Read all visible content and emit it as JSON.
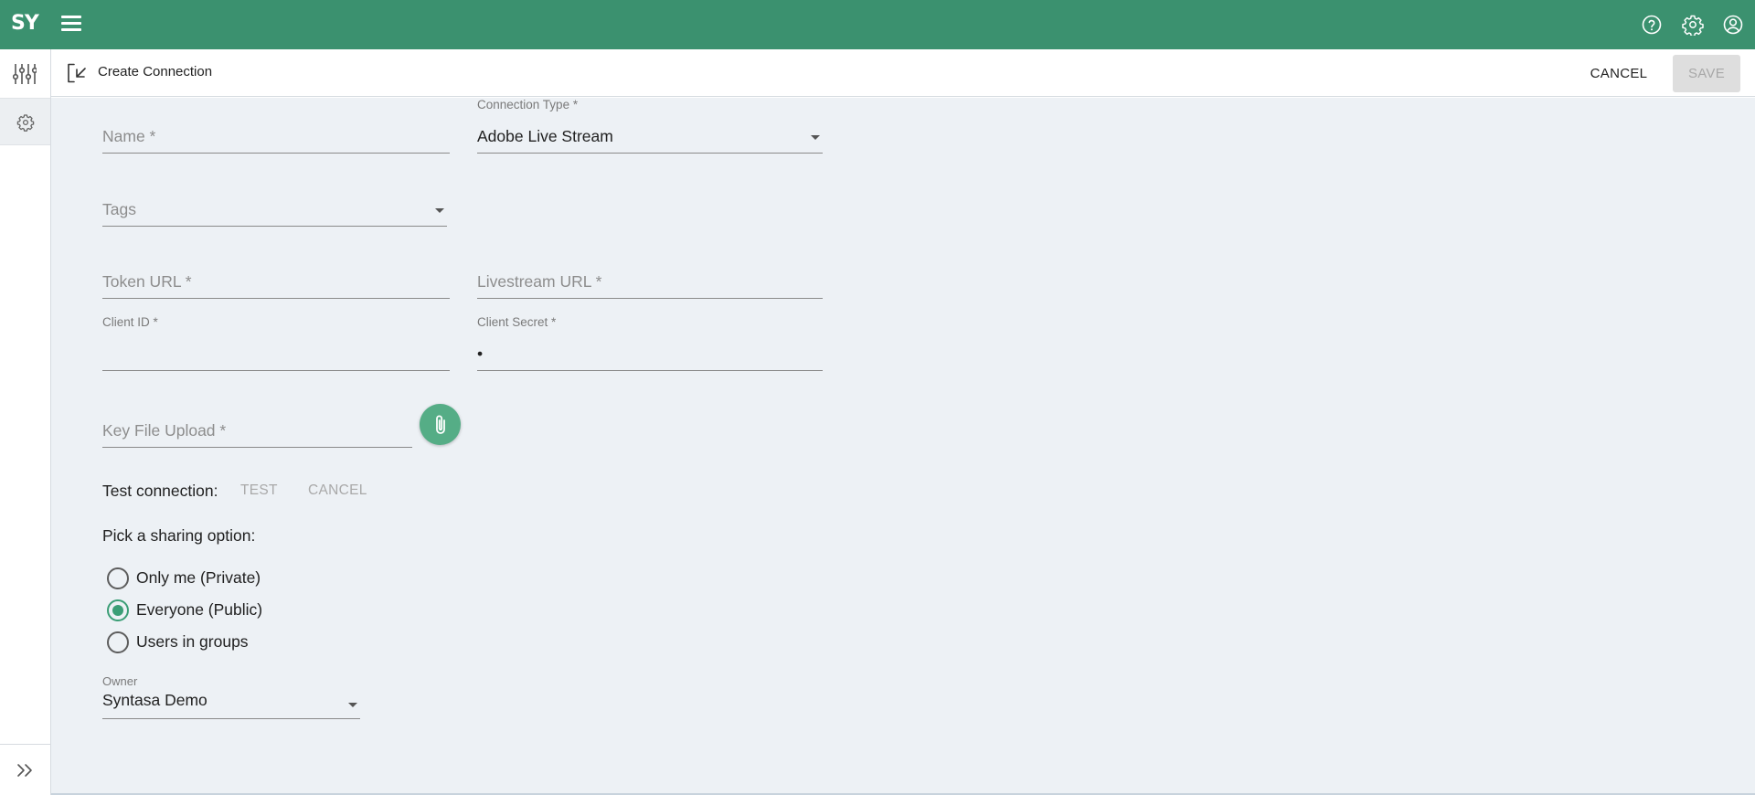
{
  "topbar": {
    "logo_text": "SY",
    "icons": [
      "menu-icon",
      "help-icon",
      "settings-icon",
      "account-icon"
    ]
  },
  "sidebar": {
    "icons": [
      "sliders-icon",
      "gear-icon",
      "expand-icon"
    ]
  },
  "header": {
    "title": "Create Connection",
    "cancel_label": "CANCEL",
    "save_label": "SAVE"
  },
  "form": {
    "name": {
      "placeholder": "Name *"
    },
    "connection_type": {
      "label": "Connection Type *",
      "value": "Adobe Live Stream"
    },
    "tags": {
      "placeholder": "Tags"
    },
    "token_url": {
      "placeholder": "Token URL *"
    },
    "livestream_url": {
      "placeholder": "Livestream URL *"
    },
    "client_id": {
      "label": "Client ID *",
      "value": ""
    },
    "client_secret": {
      "label": "Client Secret *",
      "value": "•"
    },
    "key_file": {
      "placeholder": "Key File Upload *"
    },
    "test_connection": {
      "label": "Test connection:",
      "test_label": "TEST",
      "cancel_label": "CANCEL"
    },
    "sharing": {
      "label": "Pick a sharing option:",
      "options": [
        {
          "label": "Only me (Private)",
          "checked": false
        },
        {
          "label": "Everyone (Public)",
          "checked": true
        },
        {
          "label": "Users in groups",
          "checked": false
        }
      ]
    },
    "owner": {
      "label": "Owner",
      "value": "Syntasa Demo"
    }
  },
  "colors": {
    "topbar": "#3b916f",
    "accent": "#3b9e76",
    "attach_button": "#55ad86",
    "background": "#edf1f5"
  }
}
